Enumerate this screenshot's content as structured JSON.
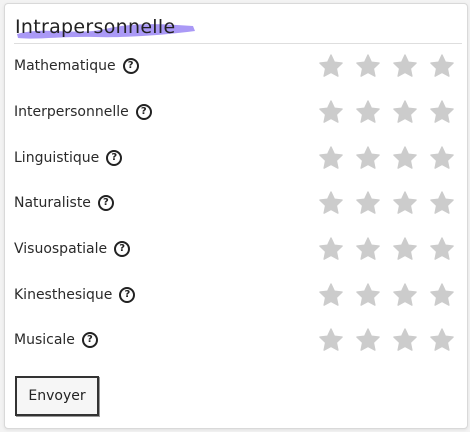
{
  "card": {
    "title": "Intrapersonnelle",
    "highlight_color": "#9b87f5"
  },
  "ratings": {
    "star_color": "#cccccc",
    "max_stars": 4,
    "items": [
      {
        "label": "Mathematique",
        "help": "?",
        "value": 0
      },
      {
        "label": "Interpersonnelle",
        "help": "?",
        "value": 0
      },
      {
        "label": "Linguistique",
        "help": "?",
        "value": 0
      },
      {
        "label": "Naturaliste",
        "help": "?",
        "value": 0
      },
      {
        "label": "Visuospatiale",
        "help": "?",
        "value": 0
      },
      {
        "label": "Kinesthesique",
        "help": "?",
        "value": 0
      },
      {
        "label": "Musicale",
        "help": "?",
        "value": 0
      }
    ]
  },
  "form": {
    "submit_label": "Envoyer"
  }
}
